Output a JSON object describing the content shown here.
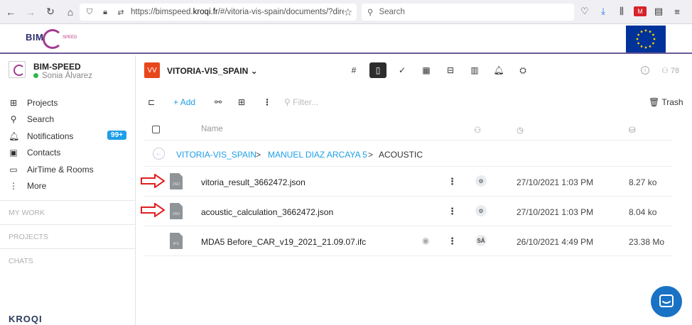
{
  "browser": {
    "url_prefix": "https://bimspeed.",
    "url_domain": "kroqi.fr",
    "url_suffix": "/#/vitoria-vis-spain/documents/?directory",
    "search_placeholder": "Search"
  },
  "banner": {
    "logo_text": "BIM",
    "logo_sub": "SPEED"
  },
  "sidebar": {
    "org_name": "BIM-SPEED",
    "user_name": "Sonia Álvarez",
    "items": [
      {
        "label": "Projects",
        "icon": "grid-icon"
      },
      {
        "label": "Search",
        "icon": "search-icon"
      },
      {
        "label": "Notifications",
        "icon": "bell-icon",
        "badge": "99+"
      },
      {
        "label": "Contacts",
        "icon": "contact-card-icon"
      },
      {
        "label": "AirTime & Rooms",
        "icon": "video-icon"
      },
      {
        "label": "More",
        "icon": "more-vertical-icon"
      }
    ],
    "sections": [
      "MY WORK",
      "PROJECTS",
      "CHATS"
    ],
    "brand": "KROQI"
  },
  "project": {
    "badge": "VV",
    "title": "VITORIA-VIS_SPAIN",
    "members_count": "78"
  },
  "toolbar": {
    "add_label": "Add",
    "filter_placeholder": "Filter...",
    "trash_label": "Trash"
  },
  "table": {
    "name_header": "Name"
  },
  "breadcrumb": {
    "items": [
      "VITORIA-VIS_SPAIN",
      "MANUEL DIAZ ARCAYA 5",
      "ACOUSTIC"
    ],
    "separator": ">"
  },
  "files": [
    {
      "type": "JSO",
      "name": "vitoria_result_3662472.json",
      "owner": "",
      "date": "27/10/2021 1:03 PM",
      "size": "8.27 ko",
      "highlighted": true
    },
    {
      "type": "JSO",
      "name": "acoustic_calculation_3662472.json",
      "owner": "",
      "date": "27/10/2021 1:03 PM",
      "size": "8.04 ko",
      "highlighted": true
    },
    {
      "type": "IFC",
      "name": "MDA5 Before_CAR_v19_2021_21.09.07.ifc",
      "owner": "SÁ",
      "date": "26/10/2021 4:49 PM",
      "size": "23.38 Mo",
      "highlighted": false
    }
  ],
  "colors": {
    "accent": "#1e9ee8",
    "project_badge": "#e8471c",
    "arrow": "#e02020",
    "banner_line": "#6b5b9a",
    "chat": "#1a72c4"
  }
}
